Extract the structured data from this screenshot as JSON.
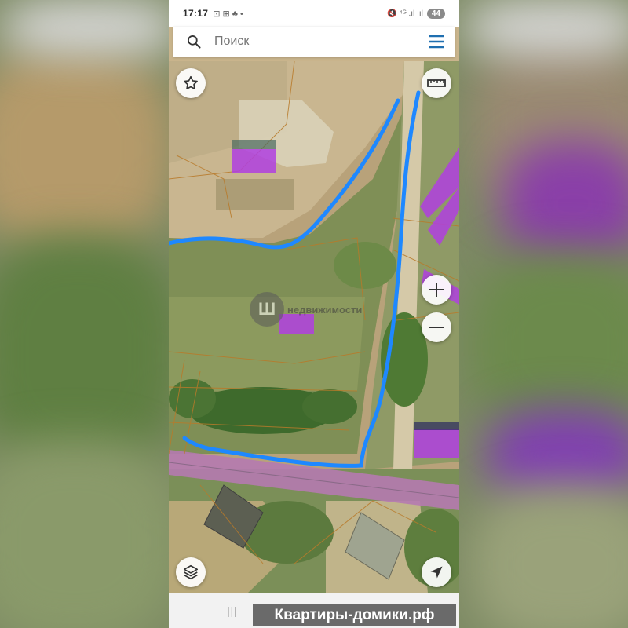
{
  "status_bar": {
    "time": "17:17",
    "left_icons": "⊡ ⊞ ♣ •",
    "right_icons": "🔇 ⁴ᴳ .ıl .ıl",
    "battery": "44"
  },
  "search": {
    "placeholder": "Поиск",
    "value": ""
  },
  "map": {
    "watermark_logo": "Ш",
    "watermark_text": "недвижимости",
    "icons": {
      "favorite": "star-icon",
      "ruler": "ruler-icon",
      "zoom_in": "plus-icon",
      "zoom_out": "minus-icon",
      "layers": "layers-icon",
      "location": "navigation-arrow-icon"
    },
    "colors": {
      "route": "#1e88ff",
      "parcel_fill": "#b040e0",
      "cadastral_line": "#b07020"
    }
  },
  "nav_bar": {
    "recent": "|||"
  },
  "banner": {
    "text": "Квартиры-домики.рф"
  }
}
